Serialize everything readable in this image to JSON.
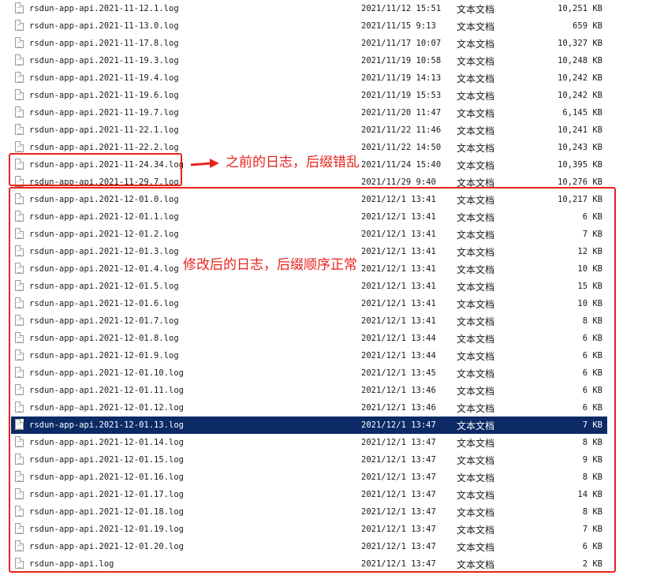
{
  "files": [
    {
      "name": "rsdun-app-api.2021-11-12.1.log",
      "date": "2021/11/12 15:51",
      "type": "文本文档",
      "size": "10,251 KB"
    },
    {
      "name": "rsdun-app-api.2021-11-13.0.log",
      "date": "2021/11/15 9:13",
      "type": "文本文档",
      "size": "659 KB"
    },
    {
      "name": "rsdun-app-api.2021-11-17.8.log",
      "date": "2021/11/17 10:07",
      "type": "文本文档",
      "size": "10,327 KB"
    },
    {
      "name": "rsdun-app-api.2021-11-19.3.log",
      "date": "2021/11/19 10:58",
      "type": "文本文档",
      "size": "10,248 KB"
    },
    {
      "name": "rsdun-app-api.2021-11-19.4.log",
      "date": "2021/11/19 14:13",
      "type": "文本文档",
      "size": "10,242 KB"
    },
    {
      "name": "rsdun-app-api.2021-11-19.6.log",
      "date": "2021/11/19 15:53",
      "type": "文本文档",
      "size": "10,242 KB"
    },
    {
      "name": "rsdun-app-api.2021-11-19.7.log",
      "date": "2021/11/20 11:47",
      "type": "文本文档",
      "size": "6,145 KB"
    },
    {
      "name": "rsdun-app-api.2021-11-22.1.log",
      "date": "2021/11/22 11:46",
      "type": "文本文档",
      "size": "10,241 KB"
    },
    {
      "name": "rsdun-app-api.2021-11-22.2.log",
      "date": "2021/11/22 14:50",
      "type": "文本文档",
      "size": "10,243 KB"
    },
    {
      "name": "rsdun-app-api.2021-11-24.34.log",
      "date": "2021/11/24 15:40",
      "type": "文本文档",
      "size": "10,395 KB"
    },
    {
      "name": "rsdun-app-api.2021-11-29.7.log",
      "date": "2021/11/29 9:40",
      "type": "文本文档",
      "size": "10,276 KB"
    },
    {
      "name": "rsdun-app-api.2021-12-01.0.log",
      "date": "2021/12/1 13:41",
      "type": "文本文档",
      "size": "10,217 KB"
    },
    {
      "name": "rsdun-app-api.2021-12-01.1.log",
      "date": "2021/12/1 13:41",
      "type": "文本文档",
      "size": "6 KB"
    },
    {
      "name": "rsdun-app-api.2021-12-01.2.log",
      "date": "2021/12/1 13:41",
      "type": "文本文档",
      "size": "7 KB"
    },
    {
      "name": "rsdun-app-api.2021-12-01.3.log",
      "date": "2021/12/1 13:41",
      "type": "文本文档",
      "size": "12 KB"
    },
    {
      "name": "rsdun-app-api.2021-12-01.4.log",
      "date": "2021/12/1 13:41",
      "type": "文本文档",
      "size": "10 KB"
    },
    {
      "name": "rsdun-app-api.2021-12-01.5.log",
      "date": "2021/12/1 13:41",
      "type": "文本文档",
      "size": "15 KB"
    },
    {
      "name": "rsdun-app-api.2021-12-01.6.log",
      "date": "2021/12/1 13:41",
      "type": "文本文档",
      "size": "10 KB"
    },
    {
      "name": "rsdun-app-api.2021-12-01.7.log",
      "date": "2021/12/1 13:41",
      "type": "文本文档",
      "size": "8 KB"
    },
    {
      "name": "rsdun-app-api.2021-12-01.8.log",
      "date": "2021/12/1 13:44",
      "type": "文本文档",
      "size": "6 KB"
    },
    {
      "name": "rsdun-app-api.2021-12-01.9.log",
      "date": "2021/12/1 13:44",
      "type": "文本文档",
      "size": "6 KB"
    },
    {
      "name": "rsdun-app-api.2021-12-01.10.log",
      "date": "2021/12/1 13:45",
      "type": "文本文档",
      "size": "6 KB"
    },
    {
      "name": "rsdun-app-api.2021-12-01.11.log",
      "date": "2021/12/1 13:46",
      "type": "文本文档",
      "size": "6 KB"
    },
    {
      "name": "rsdun-app-api.2021-12-01.12.log",
      "date": "2021/12/1 13:46",
      "type": "文本文档",
      "size": "6 KB"
    },
    {
      "name": "rsdun-app-api.2021-12-01.13.log",
      "date": "2021/12/1 13:47",
      "type": "文本文档",
      "size": "7 KB",
      "selected": true
    },
    {
      "name": "rsdun-app-api.2021-12-01.14.log",
      "date": "2021/12/1 13:47",
      "type": "文本文档",
      "size": "8 KB"
    },
    {
      "name": "rsdun-app-api.2021-12-01.15.log",
      "date": "2021/12/1 13:47",
      "type": "文本文档",
      "size": "9 KB"
    },
    {
      "name": "rsdun-app-api.2021-12-01.16.log",
      "date": "2021/12/1 13:47",
      "type": "文本文档",
      "size": "8 KB"
    },
    {
      "name": "rsdun-app-api.2021-12-01.17.log",
      "date": "2021/12/1 13:47",
      "type": "文本文档",
      "size": "14 KB"
    },
    {
      "name": "rsdun-app-api.2021-12-01.18.log",
      "date": "2021/12/1 13:47",
      "type": "文本文档",
      "size": "8 KB"
    },
    {
      "name": "rsdun-app-api.2021-12-01.19.log",
      "date": "2021/12/1 13:47",
      "type": "文本文档",
      "size": "7 KB"
    },
    {
      "name": "rsdun-app-api.2021-12-01.20.log",
      "date": "2021/12/1 13:47",
      "type": "文本文档",
      "size": "6 KB"
    },
    {
      "name": "rsdun-app-api.log",
      "date": "2021/12/1 13:47",
      "type": "文本文档",
      "size": "2 KB"
    }
  ],
  "annotations": {
    "old_label": "之前的日志，后缀错乱",
    "new_label": "修改后的日志，后缀顺序正常",
    "color": "#e8231c"
  },
  "colors": {
    "selection": "#0b2a66"
  }
}
